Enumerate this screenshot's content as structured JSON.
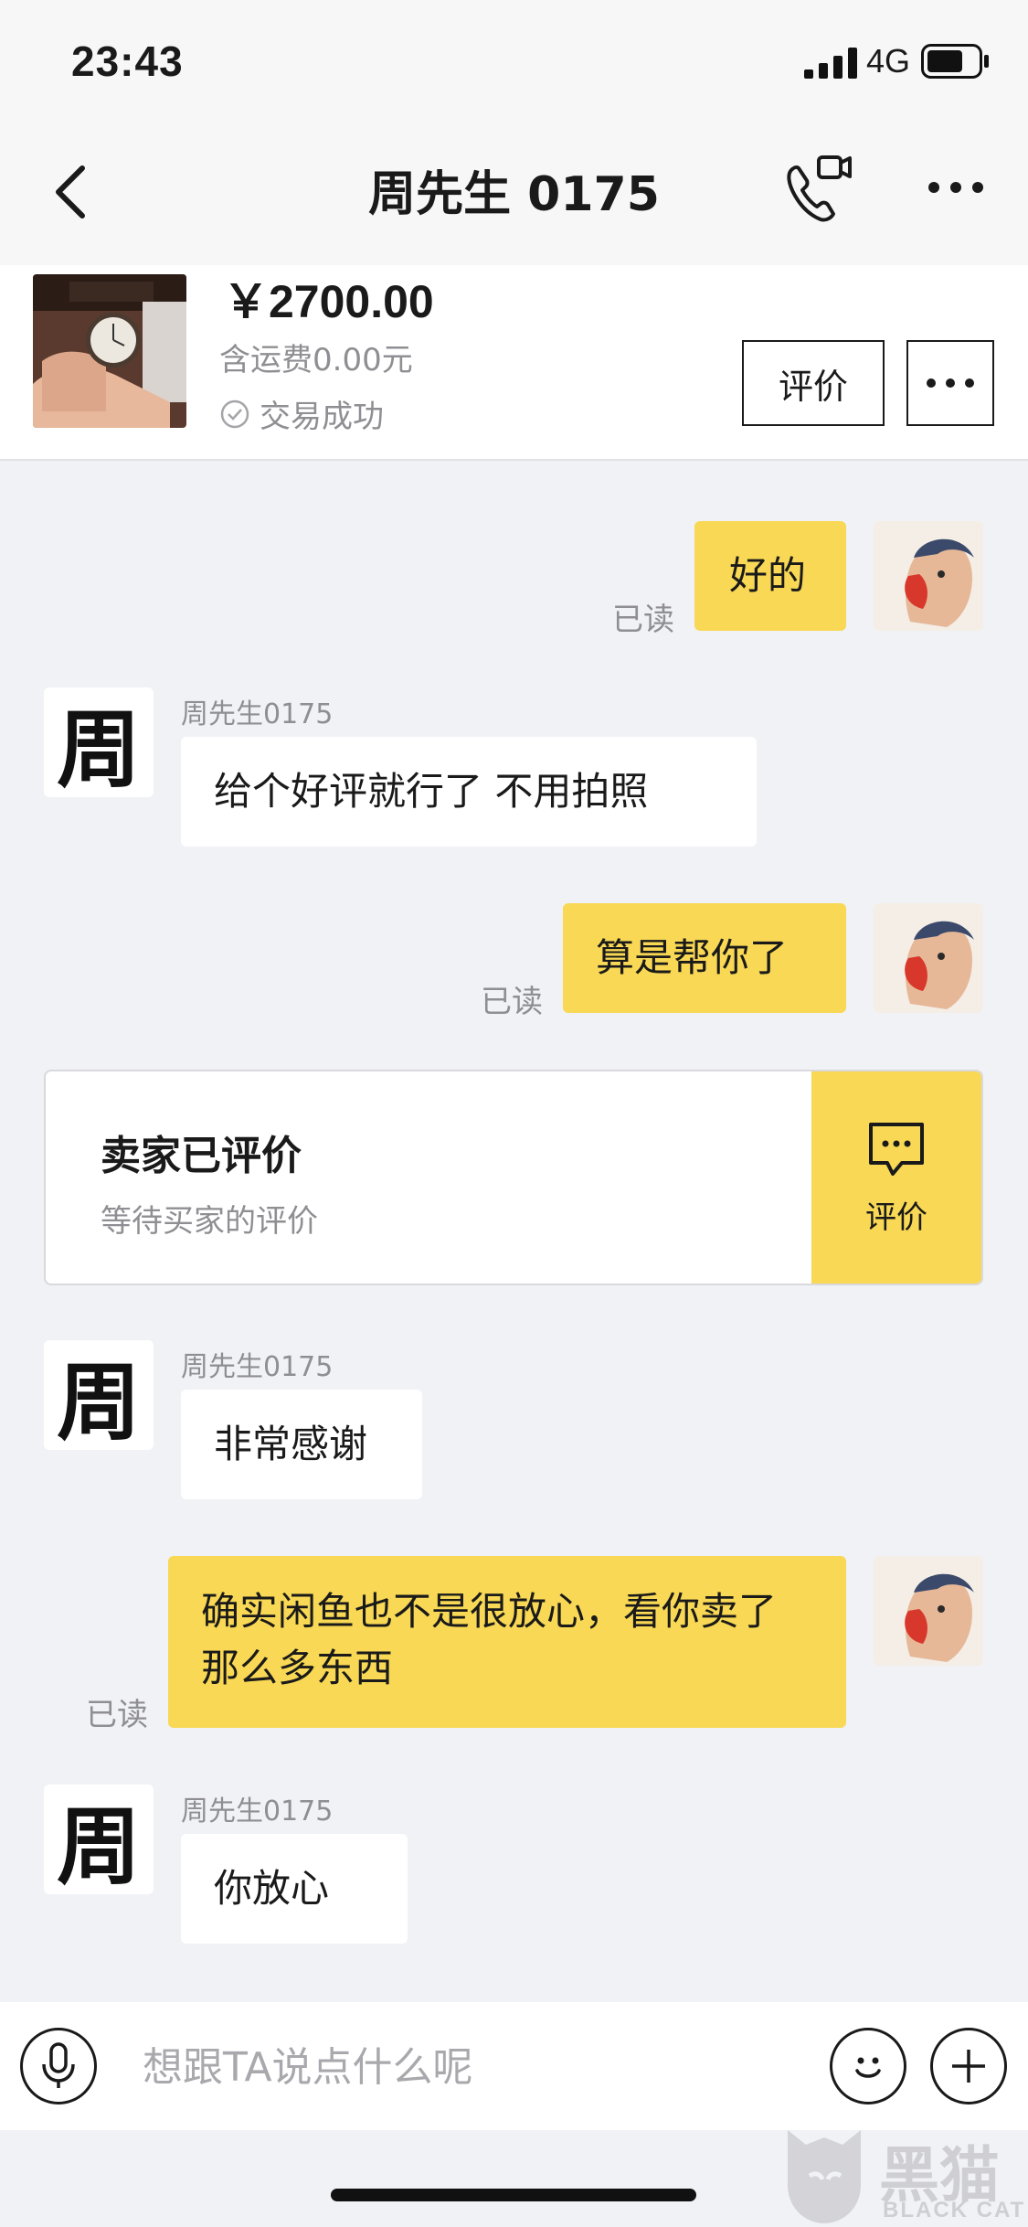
{
  "status_bar": {
    "time": "23:43",
    "network": "4G",
    "icons": [
      "signal-icon",
      "battery-icon"
    ]
  },
  "nav": {
    "title": "周先生 0175",
    "icons": [
      "back-icon",
      "video-call-icon",
      "more-icon"
    ]
  },
  "product": {
    "price": "￥2700.00",
    "shipping": "含运费0.00元",
    "status": "交易成功",
    "review_button": "评价"
  },
  "messages": [
    {
      "direction": "outgoing",
      "text": "好的",
      "read": "已读"
    },
    {
      "direction": "incoming",
      "sender": "周先生0175",
      "text": "给个好评就行了  不用拍照"
    },
    {
      "direction": "outgoing",
      "text": "算是帮你了",
      "read": "已读"
    },
    {
      "direction": "incoming",
      "sender": "周先生0175",
      "text": "非常感谢"
    },
    {
      "direction": "outgoing",
      "text": "确实闲鱼也不是很放心，看你卖了那么多东西",
      "read": "已读"
    },
    {
      "direction": "incoming",
      "sender": "周先生0175",
      "text": "你放心"
    }
  ],
  "review_card": {
    "title": "卖家已评价",
    "subtitle": "等待买家的评价",
    "action_label": "评价"
  },
  "avatar_seller_char": "周",
  "input": {
    "placeholder": "想跟TA说点什么呢"
  },
  "watermark": {
    "text_cn": "黑猫",
    "text_en": "BLACK CAT"
  },
  "colors": {
    "accent_yellow": "#f8d854",
    "background": "#f1f2f6",
    "muted_text": "#8f8f93"
  }
}
